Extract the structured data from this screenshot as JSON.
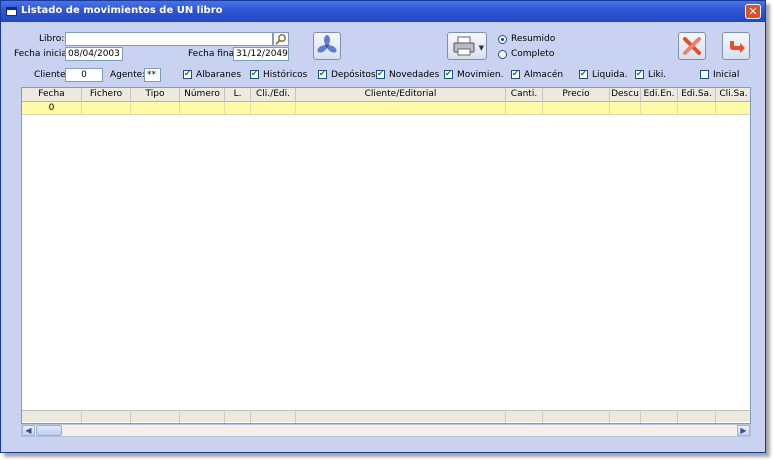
{
  "window": {
    "title": "Listado de movimientos de UN libro",
    "close_label": "✕"
  },
  "form": {
    "libro_label": "Libro:",
    "libro_value": "",
    "fecha_inicial_label": "Fecha inicial:",
    "fecha_inicial_value": "08/04/2003",
    "fecha_final_label": "Fecha final:",
    "fecha_final_value": "31/12/2049",
    "cliente_label": "Cliente:",
    "cliente_value": "0",
    "agente_label": "Agente:",
    "agente_value": "**"
  },
  "report_mode": {
    "options": [
      {
        "label": "Resumido",
        "selected": true
      },
      {
        "label": "Completo",
        "selected": false
      }
    ]
  },
  "filters": [
    {
      "label": "Albaranes",
      "checked": true
    },
    {
      "label": "Históricos",
      "checked": true
    },
    {
      "label": "Depósitos",
      "checked": true
    },
    {
      "label": "Novedades",
      "checked": true
    },
    {
      "label": "Movimien.",
      "checked": true
    },
    {
      "label": "Almacén",
      "checked": true
    },
    {
      "label": "Liquida.",
      "checked": true
    },
    {
      "label": "Liki.",
      "checked": true
    },
    {
      "label": "Inicial",
      "checked": false
    }
  ],
  "grid": {
    "columns": [
      "Fecha",
      "Fichero",
      "Tipo",
      "Número",
      "L.",
      "Cli./Edi.",
      "Cliente/Editorial",
      "Canti.",
      "Precio",
      "Descu",
      "Edi.En.",
      "Edi.Sa.",
      "Cli.Sa."
    ],
    "rows": [
      [
        "0",
        "",
        "",
        "",
        "",
        "",
        "",
        "",
        "",
        "",
        "",
        "",
        ""
      ]
    ]
  },
  "icons": {
    "search": "magnifier-icon",
    "fan": "fan-icon",
    "print": "printer-icon",
    "tools": "tools-icon",
    "exit": "exit-arrow-icon"
  },
  "colors": {
    "title_bar": "#2f56d2",
    "window_bg": "#c9d2f0",
    "selected_row": "#fff9a8",
    "grid_header": "#eceadf"
  }
}
